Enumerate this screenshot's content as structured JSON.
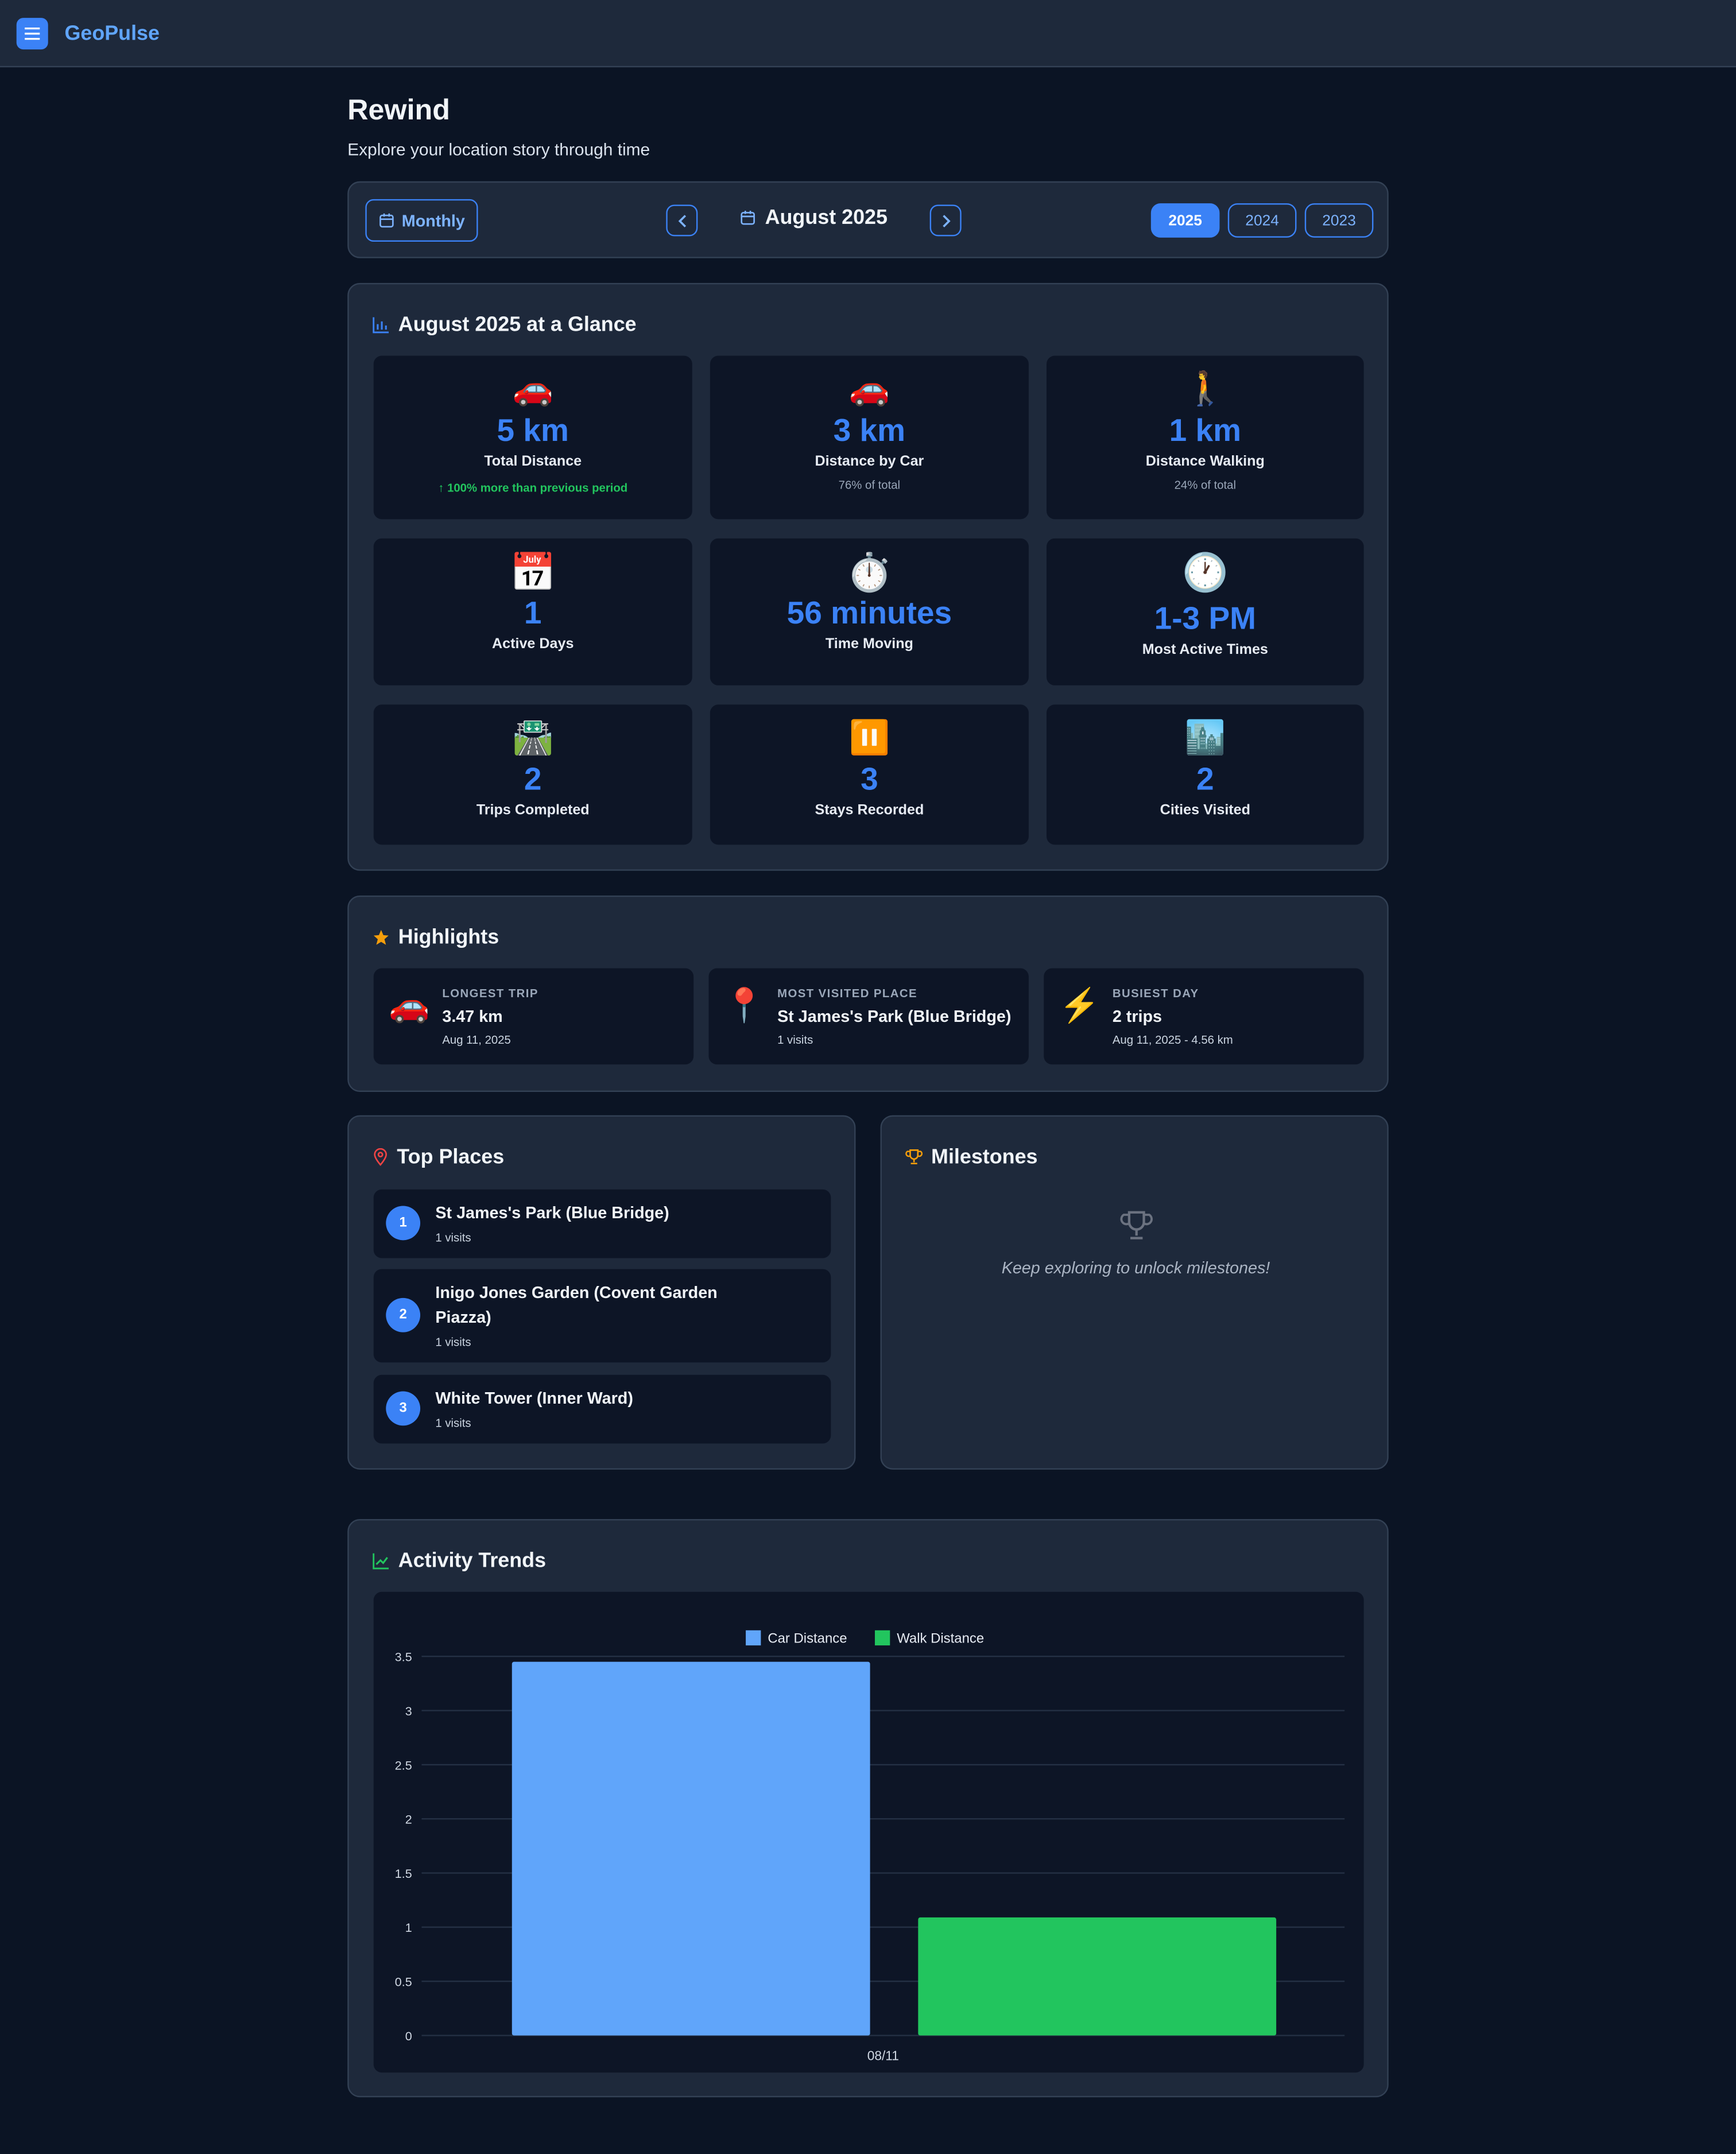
{
  "app": {
    "brand": "GeoPulse"
  },
  "page": {
    "title": "Rewind",
    "subtitle": "Explore your location story through time"
  },
  "nav": {
    "period_label": "Monthly",
    "current_period": "August 2025",
    "years": [
      "2025",
      "2024",
      "2023"
    ],
    "active_year": "2025"
  },
  "glance": {
    "title": "August 2025 at a Glance",
    "stats": [
      {
        "emoji": "🚗",
        "value": "5 km",
        "label": "Total Distance",
        "sub": "↑ 100% more than previous period"
      },
      {
        "emoji": "🚗",
        "value": "3 km",
        "label": "Distance by Car",
        "sub": "76% of total"
      },
      {
        "emoji": "🚶",
        "value": "1 km",
        "label": "Distance Walking",
        "sub": "24% of total"
      },
      {
        "emoji": "📅",
        "value": "1",
        "label": "Active Days"
      },
      {
        "emoji": "⏱️",
        "value": "56 minutes",
        "label": "Time Moving"
      },
      {
        "emoji": "🕐",
        "value": "1-3 PM",
        "label": "Most Active Times"
      },
      {
        "emoji": "🛣️",
        "value": "2",
        "label": "Trips Completed"
      },
      {
        "emoji": "⏸️",
        "value": "3",
        "label": "Stays Recorded"
      },
      {
        "emoji": "🏙️",
        "value": "2",
        "label": "Cities Visited"
      }
    ]
  },
  "highlights": {
    "title": "Highlights",
    "items": [
      {
        "emoji": "🚗",
        "caption": "LONGEST TRIP",
        "value": "3.47 km",
        "sub": "Aug 11, 2025"
      },
      {
        "emoji": "📍",
        "caption": "MOST VISITED PLACE",
        "value": "St James's Park (Blue Bridge)",
        "sub": "1 visits"
      },
      {
        "emoji": "⚡",
        "caption": "BUSIEST DAY",
        "value": "2 trips",
        "sub": "Aug 11, 2025 - 4.56 km"
      }
    ]
  },
  "top_places": {
    "title": "Top Places",
    "items": [
      {
        "rank": "1",
        "name": "St James's Park (Blue Bridge)",
        "visits": "1 visits"
      },
      {
        "rank": "2",
        "name": "Inigo Jones Garden (Covent Garden Piazza)",
        "visits": "1 visits"
      },
      {
        "rank": "3",
        "name": "White Tower (Inner Ward)",
        "visits": "1 visits"
      }
    ]
  },
  "milestones": {
    "title": "Milestones",
    "empty_text": "Keep exploring to unlock milestones!"
  },
  "trends": {
    "title": "Activity Trends"
  },
  "colors": {
    "accent": "#3b82f6",
    "car": "#60a5fa",
    "walk": "#22c55e",
    "bg": "#0b1424",
    "card": "#1e293b"
  },
  "chart_data": {
    "type": "bar",
    "categories": [
      "08/11"
    ],
    "series": [
      {
        "name": "Car Distance",
        "values": [
          3.45
        ],
        "color": "#60a5fa"
      },
      {
        "name": "Walk Distance",
        "values": [
          1.09
        ],
        "color": "#22c55e"
      }
    ],
    "ylim": [
      0,
      3.5
    ],
    "yticks": [
      "0",
      "0.5",
      "1",
      "1.5",
      "2",
      "2.5",
      "3",
      "3.5"
    ],
    "legend": "top-center",
    "grid": true
  }
}
